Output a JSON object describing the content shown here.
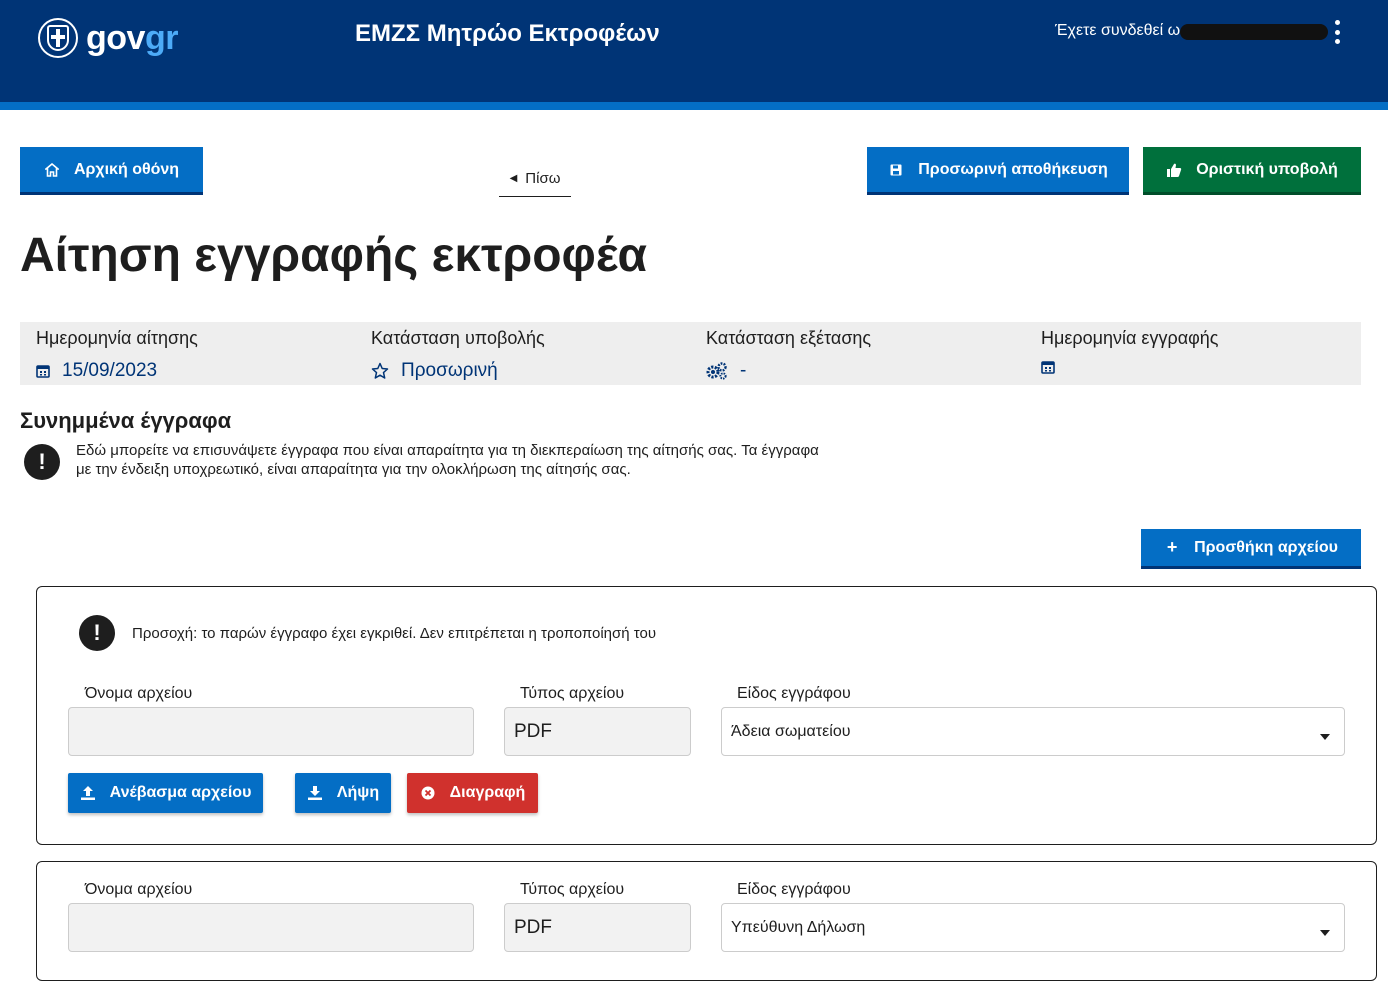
{
  "header": {
    "logo_prefix": "gov",
    "logo_suffix": "gr",
    "app_title": "ΕΜΖΣ Μητρώο Εκτροφέων",
    "user_label": "Έχετε συνδεθεί ως"
  },
  "toolbar": {
    "home_label": "Αρχική οθόνη",
    "back_label": "Πίσω",
    "save_label": "Προσωρινή αποθήκευση",
    "submit_label": "Οριστική υποβολή"
  },
  "page": {
    "title": "Αίτηση εγγραφής εκτροφέα"
  },
  "info": {
    "application_date_label": "Ημερομηνία αίτησης",
    "application_date_value": "15/09/2023",
    "submission_status_label": "Κατάσταση υποβολής",
    "submission_status_value": "Προσωρινή",
    "review_status_label": "Κατάσταση εξέτασης",
    "review_status_value": "-",
    "registration_date_label": "Ημερομηνία εγγραφής",
    "registration_date_value": ""
  },
  "attachments": {
    "title": "Συνημμένα έγγραφα",
    "notice": "Εδώ μπορείτε να επισυνάψετε έγγραφα που είναι απαραίτητα για τη διεκπεραίωση της αίτησής σας. Τα έγγραφα με την ένδειξη υποχρεωτικό, είναι απαραίτητα για την ολοκλήρωση της αίτησής σας.",
    "add_file_label": "Προσθήκη αρχείου",
    "files": [
      {
        "warning": "Προσοχή: το παρών έγγραφο έχει εγκριθεί. Δεν επιτρέπεται η τροποποίησή του",
        "file_name_label": "Όνομα αρχείου",
        "file_name_value": "",
        "file_type_label": "Τύπος αρχείου",
        "file_type_value": "PDF",
        "doc_type_label": "Είδος εγγράφου",
        "doc_type_value": "Άδεια σωματείου",
        "upload_label": "Ανέβασμα αρχείου",
        "download_label": "Λήψη",
        "delete_label": "Διαγραφή"
      },
      {
        "file_name_label": "Όνομα αρχείου",
        "file_name_value": "",
        "file_type_label": "Τύπος αρχείου",
        "file_type_value": "PDF",
        "doc_type_label": "Είδος εγγράφου",
        "doc_type_value": "Υπεύθυνη Δήλωση"
      }
    ]
  },
  "colors": {
    "header_bg": "#003476",
    "header_stripe": "#046ec5",
    "primary": "#046ec5",
    "success": "#00703c",
    "danger": "#d0312d"
  }
}
